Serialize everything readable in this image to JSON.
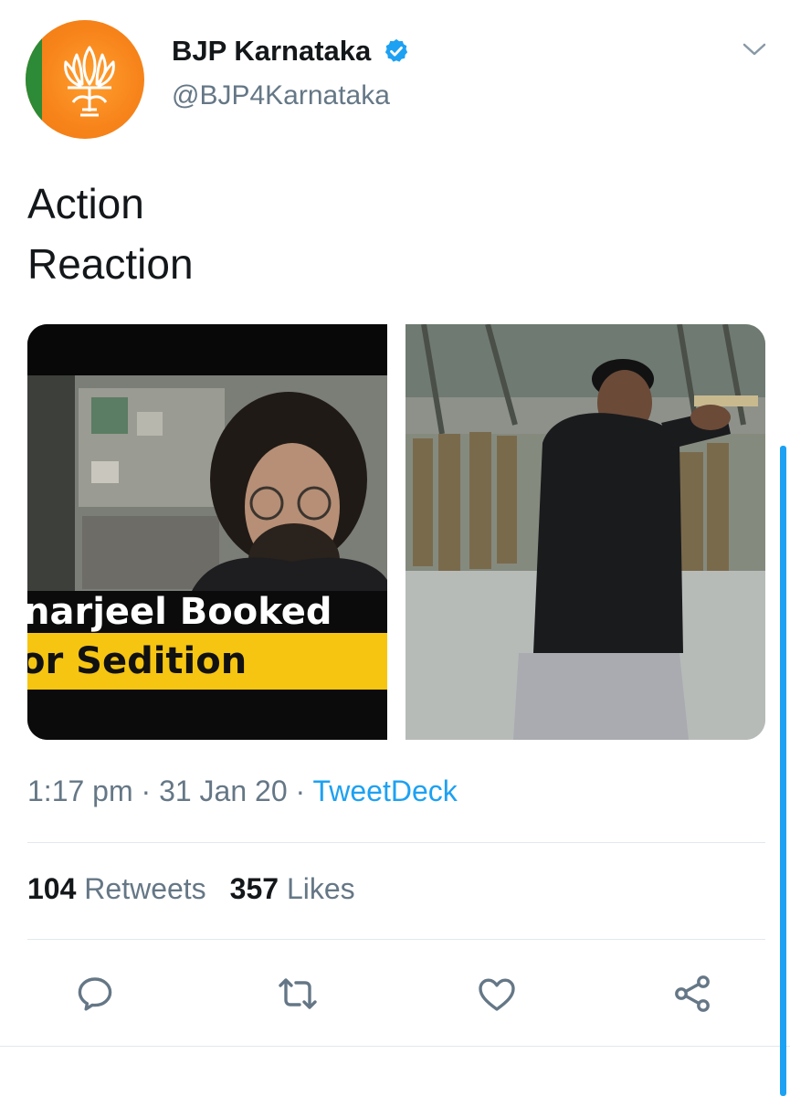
{
  "author": {
    "display_name": "BJP Karnataka",
    "handle": "@BJP4Karnataka",
    "verified": true,
    "avatar_icon": "lotus-logo-icon"
  },
  "tweet": {
    "lines": [
      "Action",
      "Reaction"
    ]
  },
  "media": [
    {
      "caption_line1": "narjeel Booked",
      "caption_line2": "or Sedition"
    },
    {
      "caption_line1": "",
      "caption_line2": ""
    }
  ],
  "meta": {
    "time": "1:17 pm",
    "separator": "·",
    "date": "31 Jan 20",
    "source": "TweetDeck"
  },
  "stats": {
    "retweets_count": "104",
    "retweets_label": "Retweets",
    "likes_count": "357",
    "likes_label": "Likes"
  },
  "actions": [
    "reply-icon",
    "retweet-icon",
    "like-icon",
    "share-icon"
  ],
  "colors": {
    "accent": "#1da1f2",
    "text": "#14171a",
    "muted": "#657786",
    "avatar_orange": "#f7841b",
    "caption_yellow": "#f6c512"
  }
}
